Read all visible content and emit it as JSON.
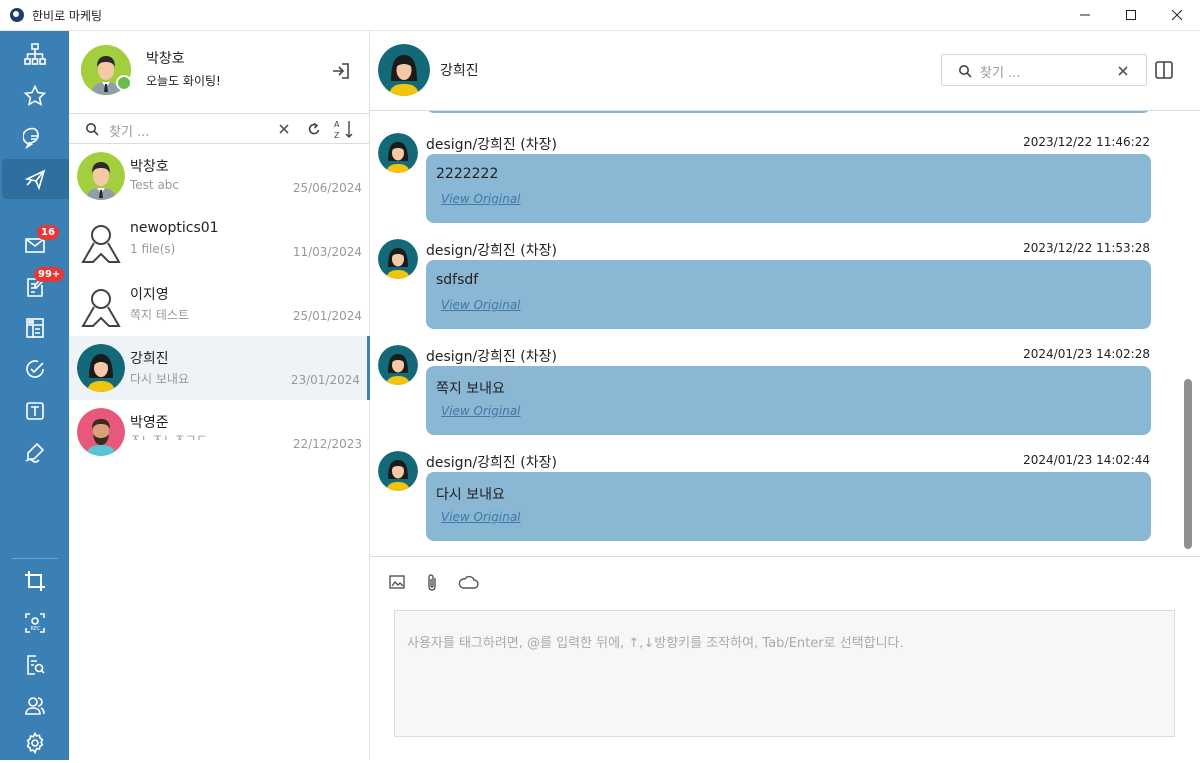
{
  "app": {
    "title": "한비로 마케팅"
  },
  "rail": {
    "badges": {
      "mail": "16",
      "notes": "99+"
    },
    "icons": [
      "org-chart-icon",
      "star-icon",
      "chat-icon",
      "message-send-icon",
      "mail-icon",
      "note-icon",
      "board-icon",
      "task-icon",
      "text-icon",
      "sign-icon",
      "crop-icon",
      "record-icon",
      "search-doc-icon",
      "users-icon",
      "gear-icon"
    ]
  },
  "profile": {
    "name": "박창호",
    "status": "오늘도 화이팅!"
  },
  "list_search": {
    "placeholder": "찾기 ..."
  },
  "conversations": [
    {
      "name": "박창호",
      "subtitle": "Test abc",
      "date": "25/06/2024"
    },
    {
      "name": "newoptics01",
      "subtitle": "1 file(s)",
      "date": "11/03/2024"
    },
    {
      "name": "이지영",
      "subtitle": "쪽지 테스트",
      "date": "25/01/2024"
    },
    {
      "name": "강희진",
      "subtitle": "다시 보내요",
      "date": "23/01/2024"
    },
    {
      "name": "박영준",
      "subtitle": "ㅈㄴㅈㄴㅈㄱㄷ",
      "date": "22/12/2023"
    }
  ],
  "chat": {
    "title": "강희진",
    "search_placeholder": "찾기 ...",
    "messages": [
      {
        "sender": "design/강희진 (차장)",
        "time": "2023/12/22 11:46:22",
        "text": "2222222",
        "link": "View Original"
      },
      {
        "sender": "design/강희진 (차장)",
        "time": "2023/12/22 11:53:28",
        "text": "sdfsdf",
        "link": "View Original"
      },
      {
        "sender": "design/강희진 (차장)",
        "time": "2024/01/23 14:02:28",
        "text": "쪽지 보내요",
        "link": "View Original"
      },
      {
        "sender": "design/강희진 (차장)",
        "time": "2024/01/23 14:02:44",
        "text": "다시 보내요",
        "link": "View Original"
      }
    ],
    "input_placeholder": "사용자를 태그하려면, @를 입력한 뒤에, ↑,↓방향키를 조작하여, Tab/Enter로 선택합니다."
  },
  "colors": {
    "rail": "#3b80b5",
    "bubble": "#8ab7d4",
    "link": "#3f79a8",
    "badge": "#e53935"
  }
}
